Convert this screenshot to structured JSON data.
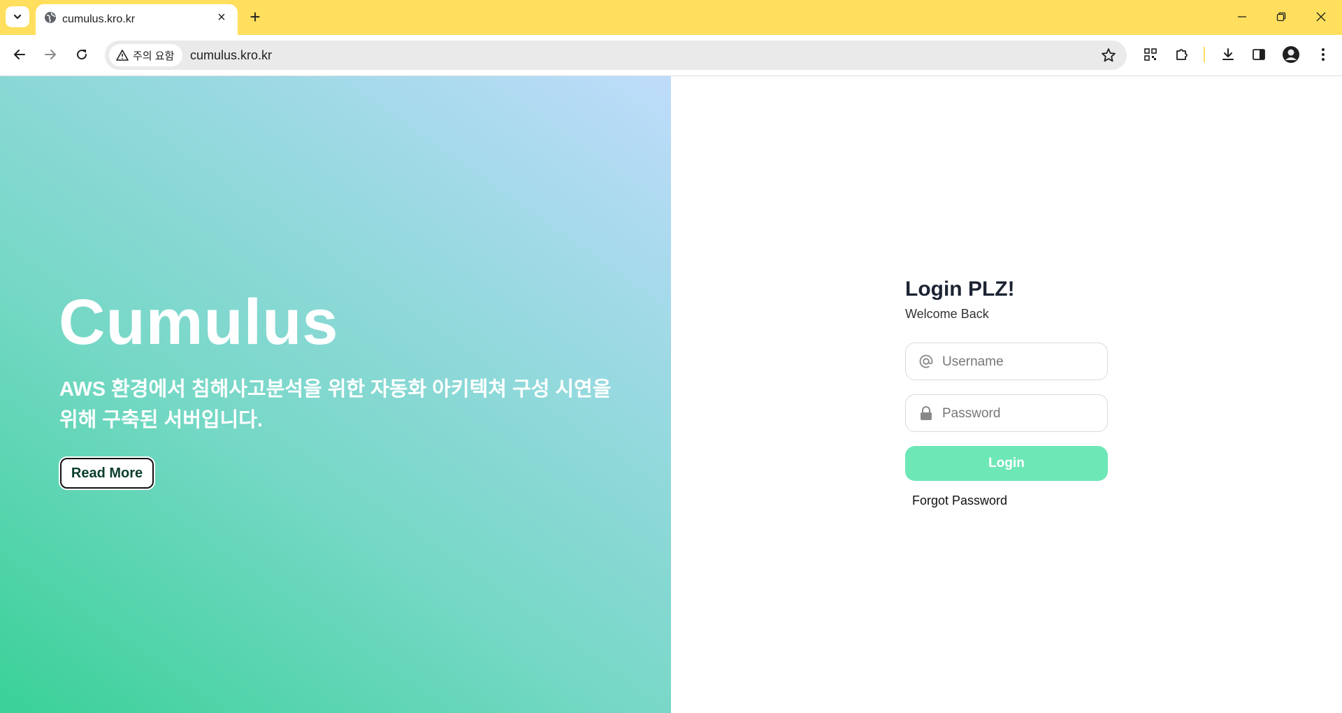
{
  "browser": {
    "tab_title": "cumulus.kro.kr",
    "security_label": "주의 요함",
    "url": "cumulus.kro.kr",
    "accent_color": "#ffdf5d"
  },
  "hero": {
    "title": "Cumulus",
    "description": "AWS 환경에서 침해사고분석을 위한 자동화 아키텍쳐 구성 시연을 위해 구축된 서버입니다.",
    "read_more_label": "Read More",
    "gradient_colors": [
      "#3ad198",
      "#bfdcfb"
    ]
  },
  "login": {
    "title": "Login PLZ!",
    "subtitle": "Welcome Back",
    "username_placeholder": "Username",
    "password_placeholder": "Password",
    "login_label": "Login",
    "forgot_label": "Forgot Password",
    "button_color": "#6ee7b7"
  }
}
